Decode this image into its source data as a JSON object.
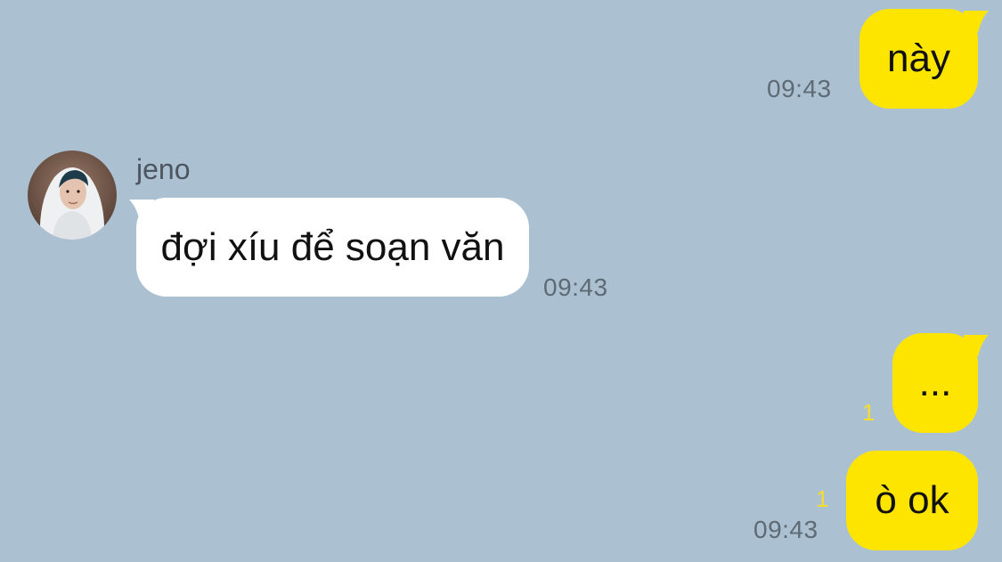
{
  "messages": [
    {
      "sender": "me",
      "text": "này",
      "time": "09:43",
      "unread": ""
    },
    {
      "sender": "jeno",
      "text": "đợi xíu để soạn văn",
      "time": "09:43"
    },
    {
      "sender": "me",
      "text": "...",
      "time": "",
      "unread": "1"
    },
    {
      "sender": "me",
      "text": "ò ok",
      "time": "09:43",
      "unread": "1"
    }
  ],
  "contact": {
    "name": "jeno",
    "avatar_icon": "profile-photo"
  },
  "colors": {
    "background": "#abc1d1",
    "my_bubble": "#fee500",
    "their_bubble": "#ffffff",
    "unread_count": "#f6dc2c"
  }
}
